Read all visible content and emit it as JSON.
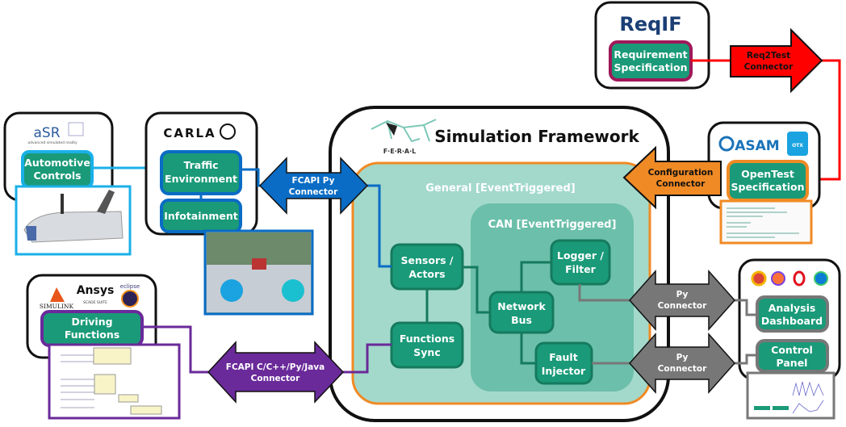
{
  "framework": {
    "title": "Simulation Framework",
    "logo": "F·E·R·A·L",
    "general_label": "General [EventTriggered]",
    "can_label": "CAN [EventTriggered]",
    "nodes": {
      "sensors": [
        "Sensors /",
        "Actors"
      ],
      "functions": [
        "Functions",
        "Sync"
      ],
      "network": [
        "Network",
        "Bus"
      ],
      "logger": [
        "Logger /",
        "Filter"
      ],
      "fault": [
        "Fault",
        "Injector"
      ]
    }
  },
  "tools": {
    "asr": {
      "logo": "aSR",
      "tagline": "advanced simulated reality",
      "node": [
        "Automotive",
        "Controls"
      ]
    },
    "carla": {
      "logo": "CARLA",
      "nodes": {
        "traffic": [
          "Traffic",
          "Environment"
        ],
        "infotainment": "Infotainment"
      }
    },
    "driving": {
      "logos": [
        "SIMULINK",
        "Ansys",
        "SCADE SUITE",
        "eclipse"
      ],
      "node": [
        "Driving",
        "Functions"
      ]
    },
    "reqif": {
      "logo": "ReqIF",
      "node": [
        "Requirement",
        "Specification"
      ]
    },
    "asam": {
      "logo": "ASAM",
      "otx": "OTX",
      "node": [
        "OpenTest",
        "Specification"
      ]
    },
    "browser": {
      "icons": [
        "chrome-icon",
        "firefox-icon",
        "opera-icon",
        "edge-icon"
      ],
      "nodes": {
        "dashboard": [
          "Analysis",
          "Dashboard"
        ],
        "control": [
          "Control",
          "Panel"
        ]
      }
    }
  },
  "connectors": {
    "fcapi_py": [
      "FCAPI Py",
      "Connector"
    ],
    "fcapi_multi": [
      "FCAPI C/C++/Py/Java",
      "Connector"
    ],
    "req2test": [
      "Req2Test",
      "Connector"
    ],
    "config": [
      "Configuration",
      "Connector"
    ],
    "py1": [
      "Py",
      "Connector"
    ],
    "py2": [
      "Py",
      "Connector"
    ]
  },
  "colors": {
    "node": "#1a9a78",
    "general": "#a3d9cb",
    "can": "#6cbfaa",
    "orange": "#f08a24",
    "blue": "#0a6cc4",
    "lightblue": "#1ab0e8",
    "purple": "#6a2a9a",
    "red": "#ff0000",
    "magenta": "#a0185a",
    "gray": "#777777"
  }
}
